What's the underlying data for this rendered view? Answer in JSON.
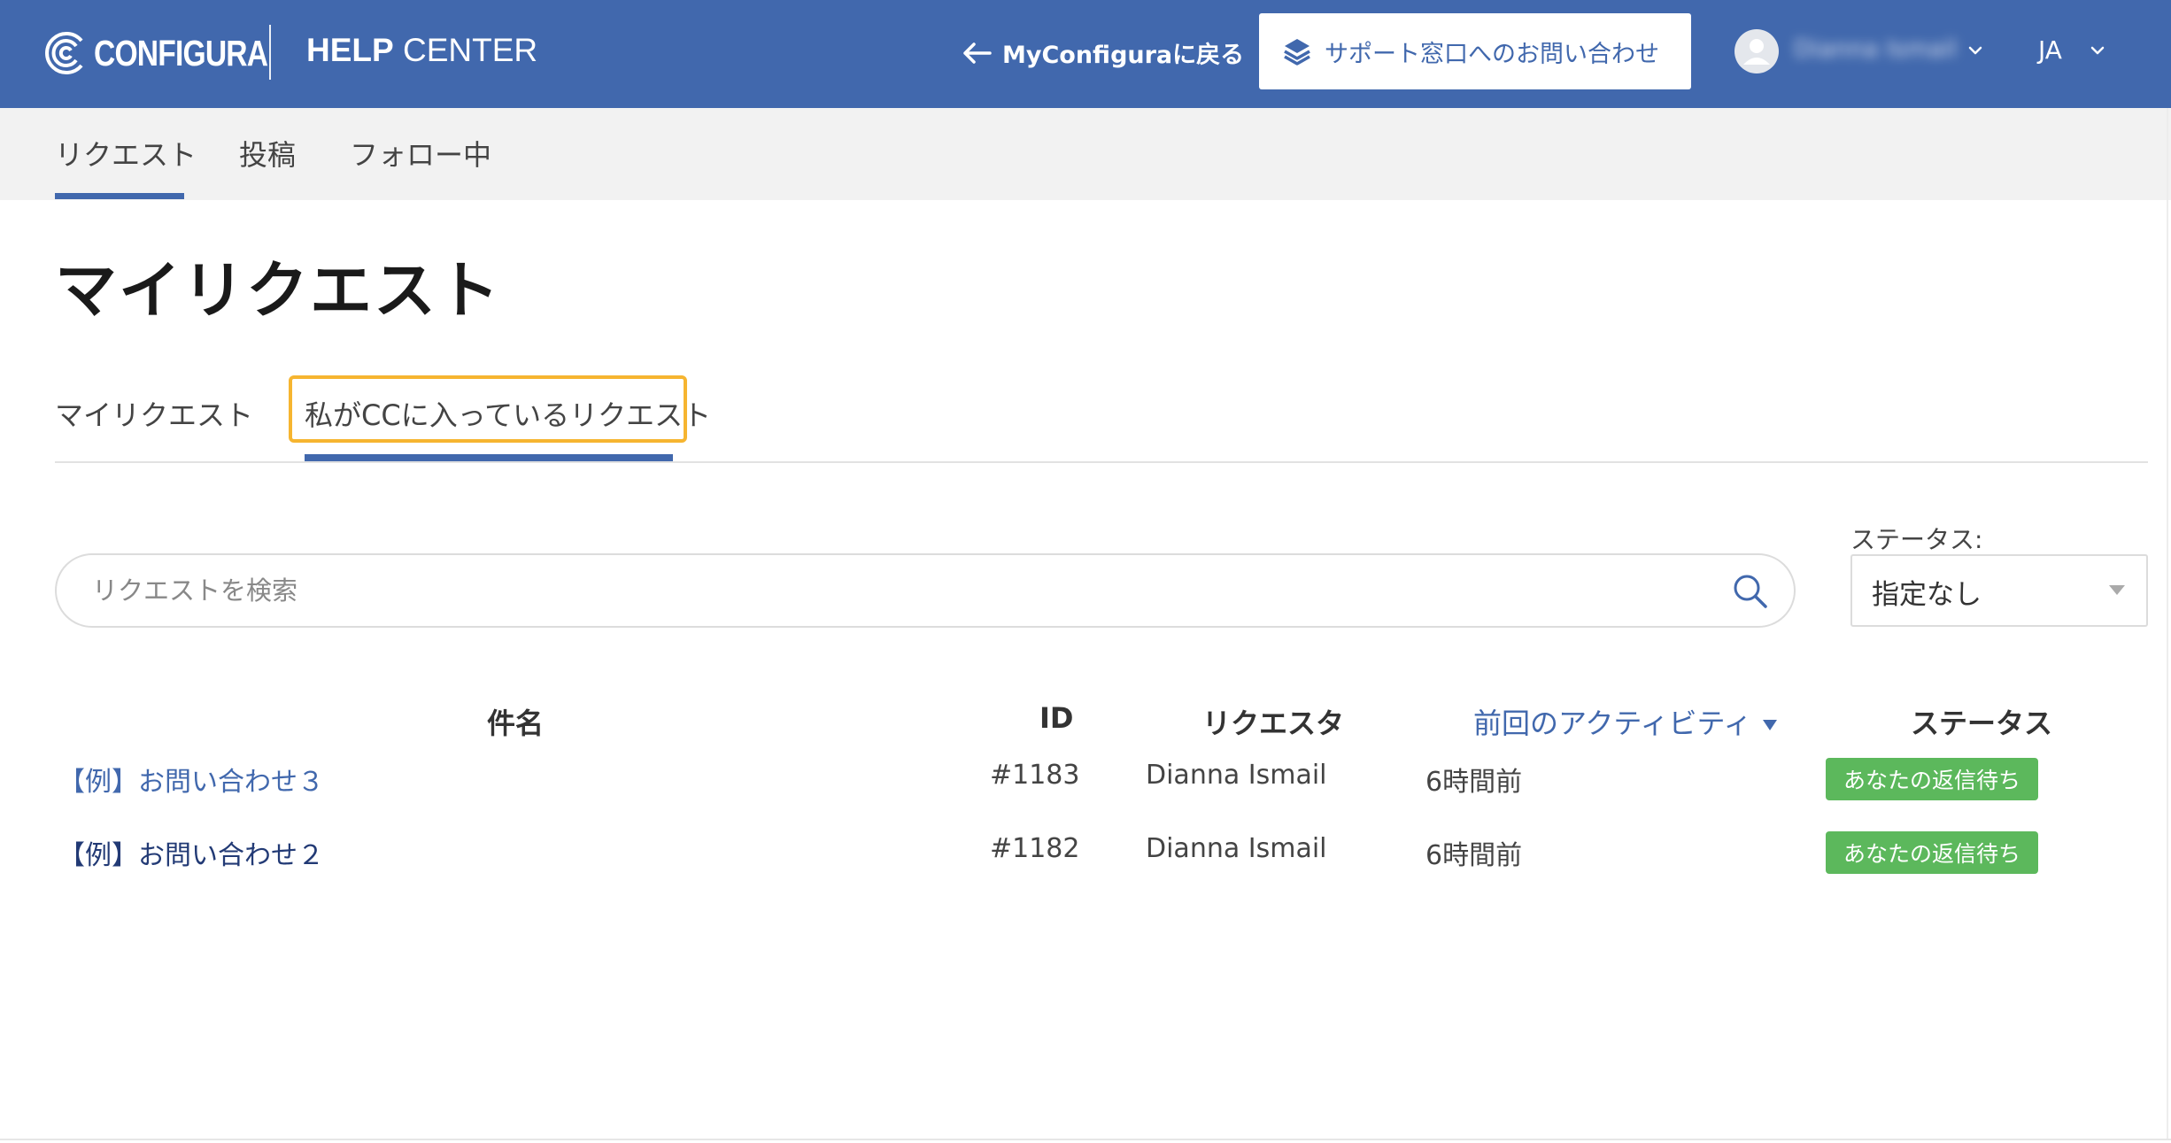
{
  "header": {
    "logo_text": "CONFIGURA",
    "help_center_bold": "HELP",
    "help_center_rest": " CENTER",
    "back_link": "MyConfiguraに戻る",
    "contact_button": "サポート窓口へのお問い合わせ",
    "user_name": "Dianna Ismail",
    "language": "JA"
  },
  "subnav": {
    "items": [
      {
        "label": "リクエスト",
        "active": true
      },
      {
        "label": "投稿",
        "active": false
      },
      {
        "label": "フォロー中",
        "active": false
      }
    ]
  },
  "page_title": "マイリクエスト",
  "tabs": [
    {
      "label": "マイリクエスト",
      "active": false
    },
    {
      "label": "私がCCに入っているリクエスト",
      "active": true
    }
  ],
  "search": {
    "placeholder": "リクエストを検索",
    "value": ""
  },
  "status_filter": {
    "label": "ステータス:",
    "selected": "指定なし"
  },
  "table": {
    "columns": {
      "subject": "件名",
      "id": "ID",
      "requester": "リクエスタ",
      "last_activity": "前回のアクティビティ",
      "status": "ステータス"
    },
    "rows": [
      {
        "subject": "【例】お問い合わせ３",
        "id": "#1183",
        "requester": "Dianna Ismail",
        "last_activity": "6時間前",
        "status": "あなたの返信待ち"
      },
      {
        "subject": "【例】お問い合わせ２",
        "id": "#1182",
        "requester": "Dianna Ismail",
        "last_activity": "6時間前",
        "status": "あなたの返信待ち"
      }
    ]
  },
  "colors": {
    "brand": "#4168ad",
    "status_badge": "#5cb85c",
    "tab_highlight": "#f6b530"
  },
  "icons": {
    "back": "arrow-left-icon",
    "contact": "layers-icon",
    "avatar": "user-avatar-icon",
    "search": "search-icon"
  }
}
